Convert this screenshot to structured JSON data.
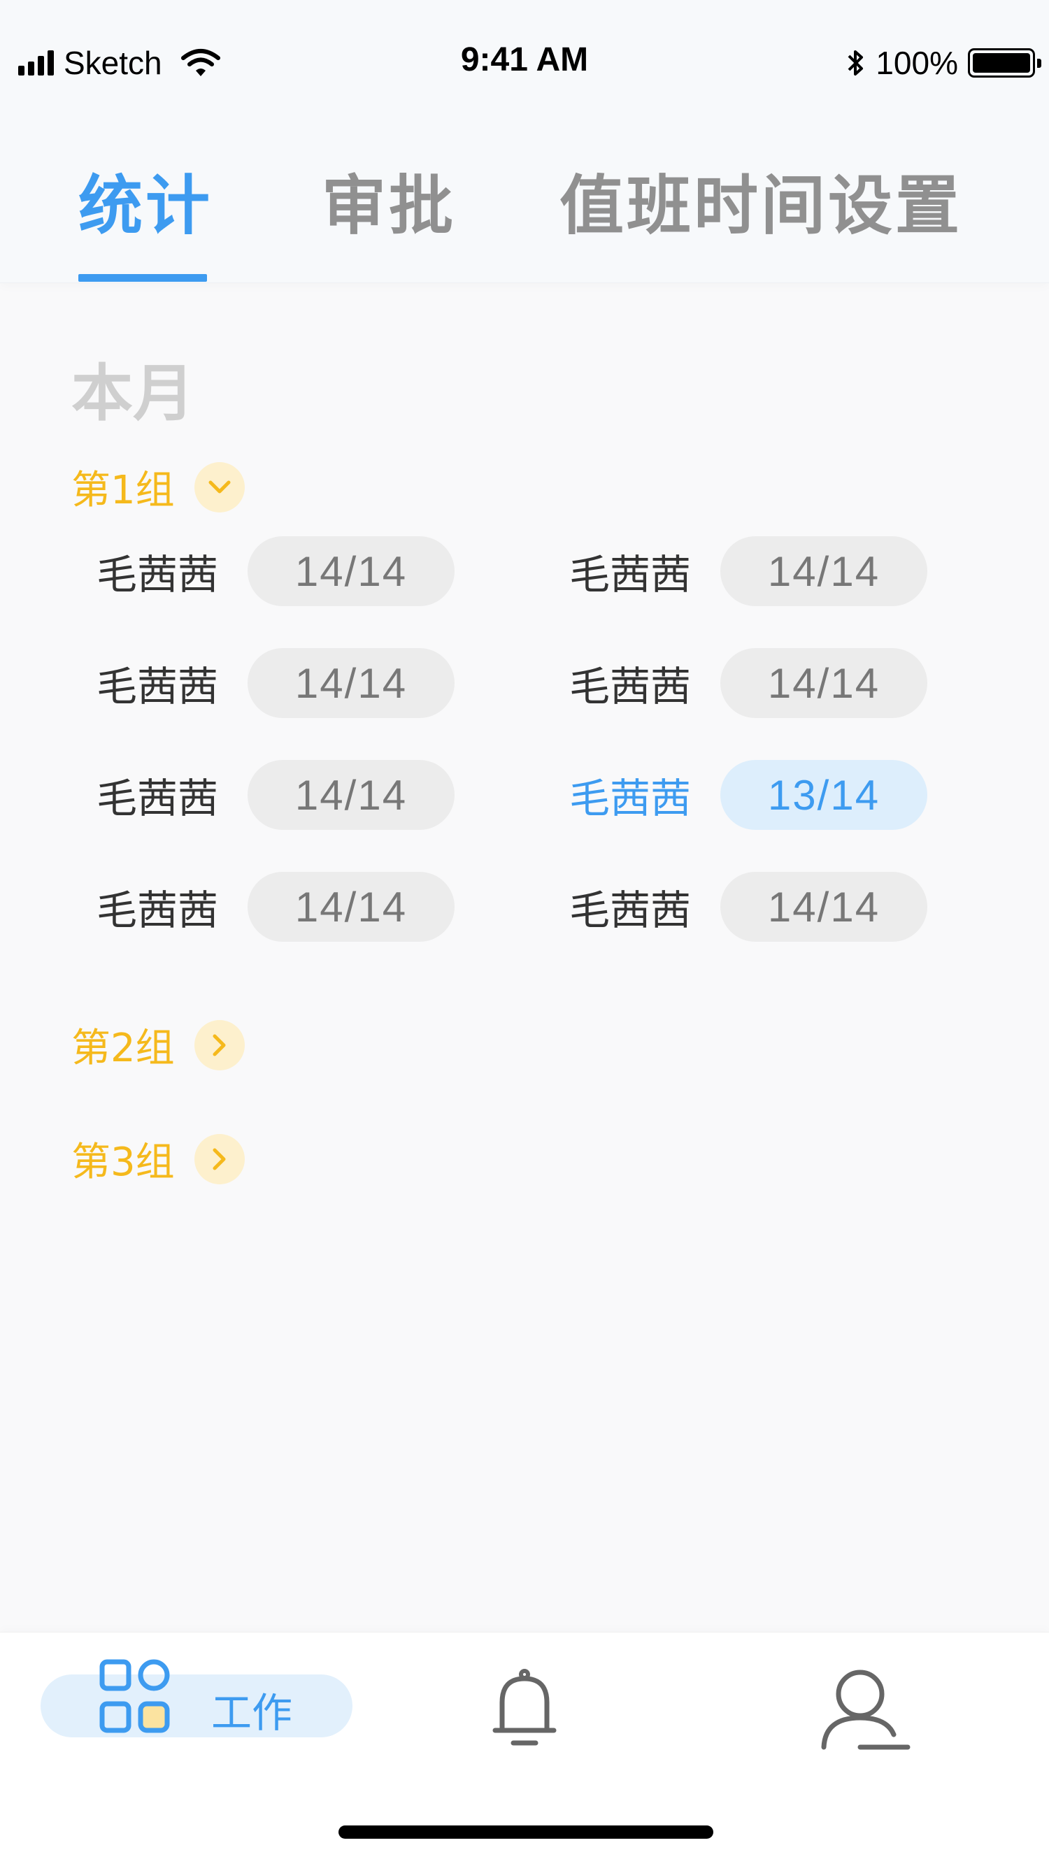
{
  "status_bar": {
    "carrier": "Sketch",
    "time": "9:41 AM",
    "battery": "100%",
    "icons": [
      "signal-icon",
      "wifi-icon",
      "bluetooth-icon",
      "battery-icon"
    ]
  },
  "tabs": [
    {
      "label": "统计",
      "active": true
    },
    {
      "label": "审批",
      "active": false
    },
    {
      "label": "值班时间设置",
      "active": false
    }
  ],
  "section_title": "本月",
  "groups": [
    {
      "label": "第1组",
      "expanded": true,
      "toggle_icon": "chevron-down-icon",
      "members": [
        {
          "name": "毛茜茜",
          "count": "14/14",
          "highlight": false
        },
        {
          "name": "毛茜茜",
          "count": "14/14",
          "highlight": false
        },
        {
          "name": "毛茜茜",
          "count": "14/14",
          "highlight": false
        },
        {
          "name": "毛茜茜",
          "count": "14/14",
          "highlight": false
        },
        {
          "name": "毛茜茜",
          "count": "14/14",
          "highlight": false
        },
        {
          "name": "毛茜茜",
          "count": "13/14",
          "highlight": true
        },
        {
          "name": "毛茜茜",
          "count": "14/14",
          "highlight": false
        },
        {
          "name": "毛茜茜",
          "count": "14/14",
          "highlight": false
        }
      ]
    },
    {
      "label": "第2组",
      "expanded": false,
      "toggle_icon": "chevron-right-icon"
    },
    {
      "label": "第3组",
      "expanded": false,
      "toggle_icon": "chevron-right-icon"
    }
  ],
  "bottom_nav": [
    {
      "label": "工作",
      "icon": "grid-icon",
      "active": true
    },
    {
      "label": "",
      "icon": "bell-icon",
      "active": false
    },
    {
      "label": "",
      "icon": "user-icon",
      "active": false
    }
  ],
  "colors": {
    "accent": "#3d9bf0",
    "group": "#f5b91c",
    "badge_bg": "#ececec",
    "highlight_bg": "#ddeefc"
  }
}
